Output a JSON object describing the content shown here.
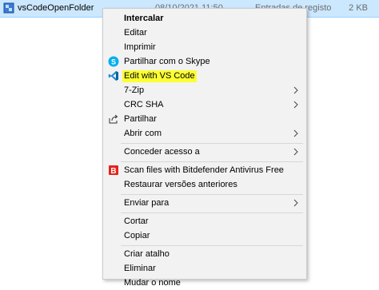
{
  "file": {
    "name": "vsCodeOpenFolder",
    "date": "08/10/2021 11:50",
    "type": "Entradas de registo",
    "size": "2 KB",
    "icon": "registry-file-icon"
  },
  "menu": {
    "items": [
      {
        "label": "Intercalar"
      },
      {
        "label": "Editar"
      },
      {
        "label": "Imprimir"
      },
      {
        "label": "Partilhar com o Skype",
        "icon": "skype-icon"
      },
      {
        "label": "Edit with VS Code",
        "icon": "vscode-icon",
        "highlight": "#fcff33"
      },
      {
        "label": "7-Zip"
      },
      {
        "label": "CRC SHA"
      },
      {
        "label": "Partilhar",
        "icon": "share-icon"
      },
      {
        "label": "Abrir com"
      },
      {
        "label": "Conceder acesso a"
      },
      {
        "label": "Scan files with Bitdefender Antivirus Free",
        "icon": "bitdefender-icon"
      },
      {
        "label": "Restaurar versões anteriores"
      },
      {
        "label": "Enviar para"
      },
      {
        "label": "Cortar"
      },
      {
        "label": "Copiar"
      },
      {
        "label": "Criar atalho"
      },
      {
        "label": "Eliminar"
      },
      {
        "label": "Mudar o nome"
      }
    ]
  },
  "colors": {
    "selection": "#cce8ff",
    "menu_bg": "#f2f2f2",
    "highlight": "#fcff33"
  }
}
